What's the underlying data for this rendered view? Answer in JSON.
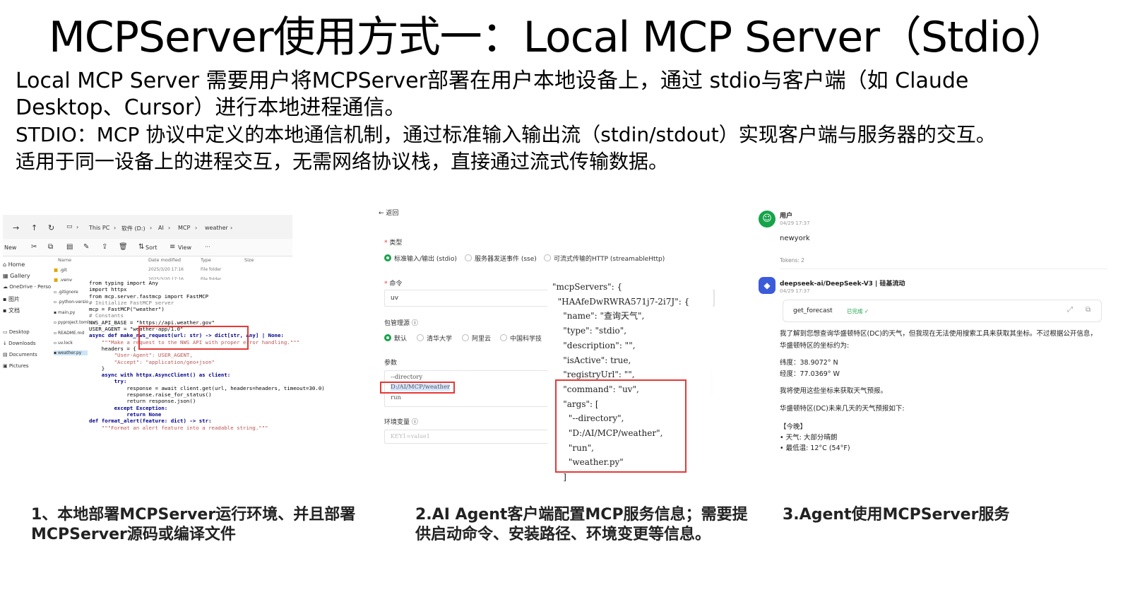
{
  "title": "MCPServer使用方式一：Local MCP Server（Stdio）",
  "paragraphs": [
    "Local MCP Server 需要用户将MCPServer部署在用户本地设备上，通过 stdio与客户端（如 Claude",
    "Desktop、Cursor）进行本地进程通信。",
    "STDIO：MCP 协议中定义的本地通信机制，通过标准输入输出流（stdin/stdout）实现客户端与服务器的交互。",
    "适用于同一设备上的进程交互，无需网络协议栈，直接通过流式传输数据。"
  ],
  "captions": {
    "c1_line1": "1、本地部署MCPServer运行环境、并且部署",
    "c1_line2": "MCPServer源码或编译文件",
    "c2_line1": "2.AI Agent客户端配置MCP服务信息；需要提",
    "c2_line2": "供启动命令、安装路径、环境变更等信息。",
    "c3_line1": "3.Agent使用MCPServer服务"
  },
  "explorer": {
    "breadcrumb": [
      "This PC",
      "软件 (D:)",
      "AI",
      "MCP",
      "weather"
    ],
    "toolbar": {
      "new": "New",
      "sort": "Sort",
      "view": "View",
      "more": "···"
    },
    "sidebar": [
      "Home",
      "Gallery",
      "OneDrive - Perso",
      "图片",
      "文档",
      "Desktop",
      "Downloads",
      "Documents",
      "Pictures"
    ],
    "columns": [
      "Name",
      "Date modified",
      "Type",
      "Size"
    ],
    "files": [
      {
        "name": ".git",
        "date": "2025/3/20 17:16",
        "type": "File folder"
      },
      {
        "name": ".venv",
        "date": "2025/3/20 17:16",
        "type": "File folder"
      },
      {
        "name": ".gitignore",
        "date": "",
        "type": ""
      },
      {
        "name": ".python-versio",
        "date": "",
        "type": ""
      },
      {
        "name": "main.py",
        "date": "",
        "type": ""
      },
      {
        "name": "pyproject.toml",
        "date": "",
        "type": ""
      },
      {
        "name": "README.md",
        "date": "",
        "type": ""
      },
      {
        "name": "uv.lock",
        "date": "",
        "type": ""
      },
      {
        "name": "weather.py",
        "date": "",
        "type": ""
      }
    ]
  },
  "code": [
    "from typing import Any",
    "import httpx",
    "from mcp.server.fastmcp import FastMCP",
    "",
    "# Initialize FastMCP server",
    "mcp = FastMCP(\"weather\")",
    "",
    "# Constants",
    "NWS_API_BASE = \"https://api.weather.gov\"",
    "USER_AGENT = \"weather-app/1.0\"",
    "",
    "async def make_nws_request(url: str) -> dict[str, Any] | None:",
    "    \"\"\"Make a request to the NWS API with proper error handling.\"\"\"",
    "    headers = {",
    "        \"User-Agent\": USER_AGENT,",
    "        \"Accept\": \"application/geo+json\"",
    "    }",
    "    async with httpx.AsyncClient() as client:",
    "        try:",
    "            response = await client.get(url, headers=headers, timeout=30.0)",
    "            response.raise_for_status()",
    "            return response.json()",
    "        except Exception:",
    "            return None",
    "",
    "def format_alert(feature: dict) -> str:",
    "    \"\"\"Format an alert feature into a readable string.\"\"\""
  ],
  "config": {
    "back": "返回",
    "type_label": "类型",
    "type_options": [
      "标准输入/输出 (stdio)",
      "服务器发送事件 (sse)",
      "可流式传输的HTTP (streamableHttp)"
    ],
    "command_label": "命令",
    "command_value": "uv",
    "pkg_label": "包管理源",
    "pkg_options": [
      "默认",
      "清华大学",
      "阿里云",
      "中国科学技"
    ],
    "args_label": "参数",
    "args": [
      "--directory",
      "D:/AI/MCP/weather",
      "run"
    ],
    "env_label": "环境变量",
    "env_placeholder": "KEY1=value1",
    "json_lines": [
      "\"mcpServers\": {",
      "  \"HAAfeDwRWRA571j7-2i7J\": {",
      "    \"name\": \"查询天气\",",
      "    \"type\": \"stdio\",",
      "    \"description\": \"\",",
      "    \"isActive\": true,",
      "    \"registryUrl\": \"\",",
      "    \"command\": \"uv\",",
      "    \"args\": [",
      "      \"--directory\",",
      "      \"D:/AI/MCP/weather\",",
      "      \"run\",",
      "      \"weather.py\"",
      "    ]",
      "  }"
    ]
  },
  "chat": {
    "user_name": "用户",
    "user_time": "04/29 17:37",
    "user_msg": "newyork",
    "tokens": "Tokens: 2",
    "bot_name": "deepseek-ai/DeepSeek-V3 | 硅基流动",
    "bot_time": "04/29 17:37",
    "tool_name": "get_forecast",
    "tool_status": "已完成 ✓",
    "reply1": "我了解到您想查询华盛顿特区(DC)的天气，但我现在无法使用搜索工具来获取其坐标。不过根据公开信息，",
    "reply1b": "华盛顿特区的坐标约为:",
    "lat": "纬度：38.9072° N",
    "lon": "经度：77.0369° W",
    "reply2": "我将使用这些坐标来获取天气预报。",
    "reply3": "华盛顿特区(DC)未来几天的天气预报如下:",
    "today": "【今晚】",
    "weather": "• 天气: 大部分晴朗",
    "low": "• 最低温: 12°C (54°F)"
  },
  "colors": {
    "accent_green": "#16a34a",
    "highlight_red": "#e53935",
    "bot_blue": "#3b5bdb"
  }
}
